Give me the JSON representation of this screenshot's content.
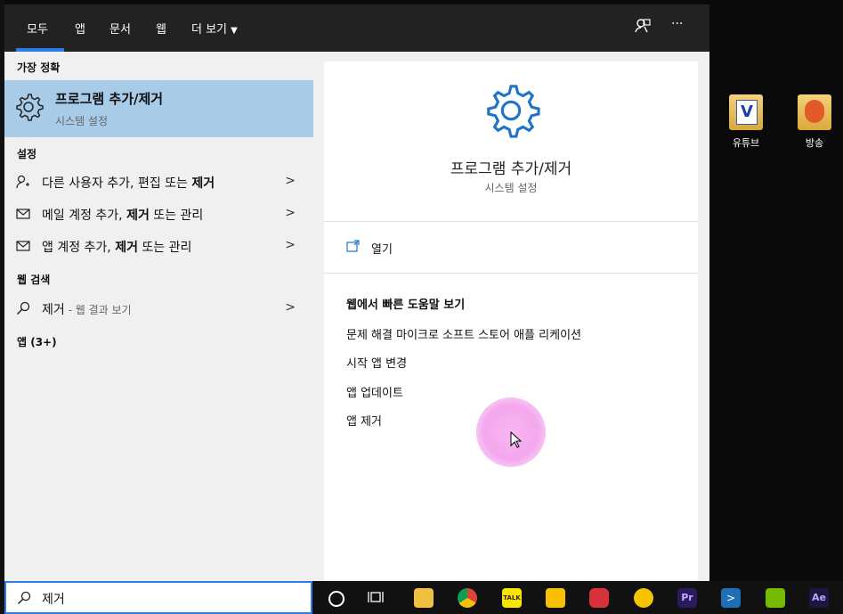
{
  "tabs": [
    "모두",
    "앱",
    "문서",
    "웹",
    "더 보기"
  ],
  "best_match": {
    "header": "가장 정확",
    "title": "프로그램 추가/제거",
    "subtitle": "시스템 설정"
  },
  "settings": {
    "header": "설정",
    "items": [
      {
        "pre": "다른 사용자 추가, 편집 또는 ",
        "bold": "제거"
      },
      {
        "pre": "메일 계정 추가, ",
        "bold": "제거",
        "post": " 또는 관리"
      },
      {
        "pre": "앱 계정 추가, ",
        "bold": "제거",
        "post": " 또는 관리"
      }
    ]
  },
  "web": {
    "header": "웹 검색",
    "query": "제거",
    "suffix": " - 웹 결과 보기"
  },
  "apps_header": "앱 (3+)",
  "detail": {
    "title": "프로그램 추가/제거",
    "subtitle": "시스템 설정",
    "open_label": "열기",
    "help_header": "웹에서 빠른 도움말 보기",
    "help_links": [
      "문제 해결 마이크로 소프트 스토어 애플 리케이션",
      "시작 앱 변경",
      "앱 업데이트",
      "앱 제거"
    ]
  },
  "desktop": {
    "icons": [
      {
        "label": "유튜브",
        "icon": "video-file-icon"
      },
      {
        "label": "방송",
        "icon": "media-file-icon"
      }
    ]
  },
  "search": {
    "value": "제거"
  },
  "taskbar": {
    "apps": [
      "file-explorer-icon",
      "chrome-icon",
      "kakaotalk-icon",
      "sticky-notes-icon",
      "creative-cloud-icon",
      "media-player-icon",
      "premiere-pro-icon",
      "powershell-icon",
      "nvidia-icon",
      "after-effects-icon"
    ],
    "premiere_label": "Pr",
    "ae_label": "Ae",
    "kakao_label": "TALK"
  },
  "colors": {
    "accent": "#2b7de9",
    "selected": "#a8cbe8"
  }
}
